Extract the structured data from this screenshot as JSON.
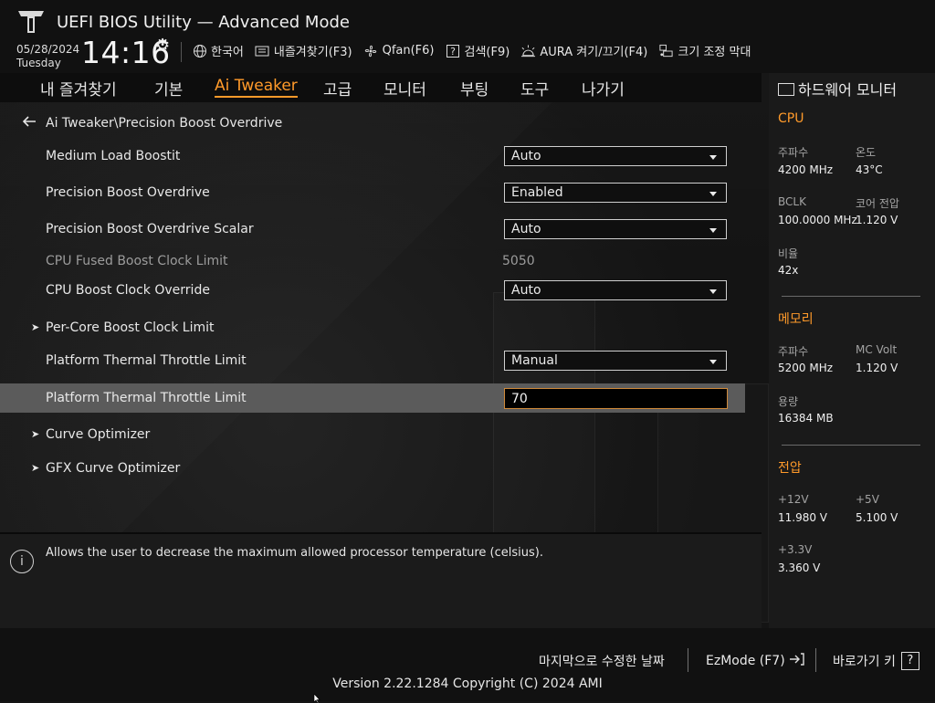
{
  "header": {
    "title": "UEFI BIOS Utility — Advanced Mode",
    "date": "05/28/2024",
    "day": "Tuesday",
    "time": "14:16",
    "toolbar": [
      {
        "icon": "globe-icon",
        "label": "한국어"
      },
      {
        "icon": "favorites-icon",
        "label": "내즐겨찾기(F3)"
      },
      {
        "icon": "fan-icon",
        "label": "Qfan(F6)"
      },
      {
        "icon": "help-search-icon",
        "label": "검색(F9)"
      },
      {
        "icon": "aura-icon",
        "label": "AURA 켜기/끄기(F4)"
      },
      {
        "icon": "resize-bar-icon",
        "label": "크기 조정 막대"
      }
    ]
  },
  "menu": {
    "items": [
      "내 즐겨찾기",
      "기본",
      "Ai Tweaker",
      "고급",
      "모니터",
      "부팅",
      "도구",
      "나가기"
    ],
    "active": "Ai Tweaker"
  },
  "breadcrumb": "Ai Tweaker\\Precision Boost Overdrive",
  "settings": [
    {
      "label": "Medium Load Boostit",
      "value": "Auto"
    },
    {
      "label": "Precision Boost Overdrive",
      "value": "Enabled"
    },
    {
      "label": "Precision Boost Overdrive Scalar",
      "value": "Auto"
    },
    {
      "label": "CPU Fused Boost Clock Limit",
      "value": "5050"
    },
    {
      "label": "CPU Boost Clock Override",
      "value": "Auto"
    },
    {
      "label": "Per-Core Boost Clock Limit"
    },
    {
      "label": "Platform Thermal Throttle Limit",
      "value": "Manual"
    },
    {
      "label": "Platform Thermal Throttle Limit",
      "value": "70"
    },
    {
      "label": "Curve Optimizer"
    },
    {
      "label": "GFX Curve Optimizer"
    }
  ],
  "help": {
    "text": "Allows the user to decrease the maximum allowed processor temperature (celsius)."
  },
  "hardware_monitor": {
    "title": "하드웨어 모니터",
    "cpu": {
      "section": "CPU",
      "freq_label": "주파수",
      "freq_value": "4200 MHz",
      "temp_label": "온도",
      "temp_value": "43°C",
      "bclk_label": "BCLK",
      "bclk_value": "100.0000 MHz",
      "vcore_label": "코어 전압",
      "vcore_value": "1.120 V",
      "ratio_label": "비율",
      "ratio_value": "42x"
    },
    "memory": {
      "section": "메모리",
      "freq_label": "주파수",
      "freq_value": "5200 MHz",
      "mcvolt_label": "MC Volt",
      "mcvolt_value": "1.120 V",
      "cap_label": "용량",
      "cap_value": "16384 MB"
    },
    "voltage": {
      "section": "전압",
      "v12_label": "+12V",
      "v12_value": "11.980 V",
      "v5_label": "+5V",
      "v5_value": "5.100 V",
      "v33_label": "+3.3V",
      "v33_value": "3.360 V"
    }
  },
  "footer": {
    "last_modified": "마지막으로 수정한 날짜",
    "ezmode": "EzMode (F7)",
    "shortcut": "바로가기 키",
    "shortcut_icon_glyph": "?",
    "version": "Version 2.22.1284 Copyright (C) 2024 AMI"
  },
  "colors": {
    "accent": "#ff9a2a",
    "highlight_row": "#5b5b5b"
  }
}
